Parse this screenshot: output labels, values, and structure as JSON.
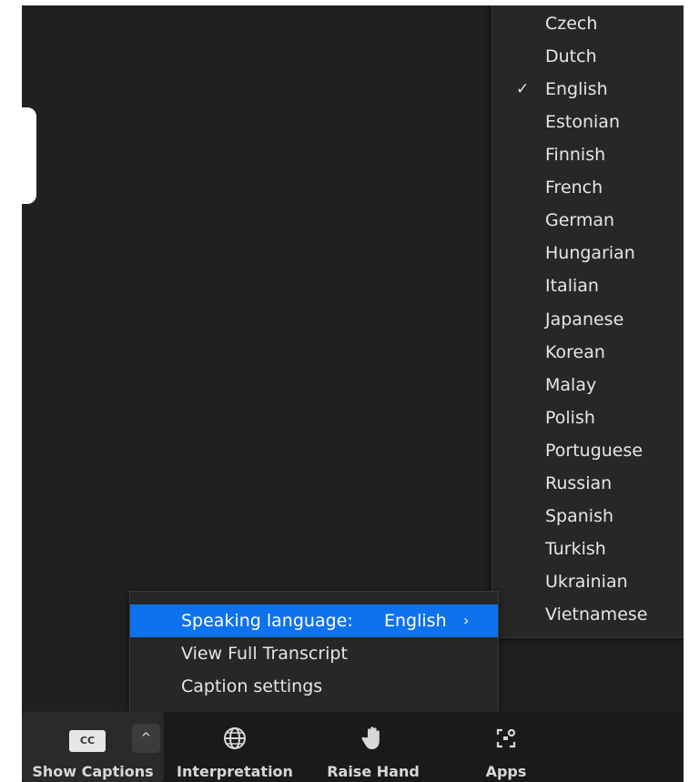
{
  "language_menu": {
    "selected": "English",
    "check_glyph": "✓",
    "items": [
      {
        "label": "Czech",
        "checked": false
      },
      {
        "label": "Dutch",
        "checked": false
      },
      {
        "label": "English",
        "checked": true
      },
      {
        "label": "Estonian",
        "checked": false
      },
      {
        "label": "Finnish",
        "checked": false
      },
      {
        "label": "French",
        "checked": false
      },
      {
        "label": "German",
        "checked": false
      },
      {
        "label": "Hungarian",
        "checked": false
      },
      {
        "label": "Italian",
        "checked": false
      },
      {
        "label": "Japanese",
        "checked": false
      },
      {
        "label": "Korean",
        "checked": false
      },
      {
        "label": "Malay",
        "checked": false
      },
      {
        "label": "Polish",
        "checked": false
      },
      {
        "label": "Portuguese",
        "checked": false
      },
      {
        "label": "Russian",
        "checked": false
      },
      {
        "label": "Spanish",
        "checked": false
      },
      {
        "label": "Turkish",
        "checked": false
      },
      {
        "label": "Ukrainian",
        "checked": false
      },
      {
        "label": "Vietnamese",
        "checked": false
      }
    ]
  },
  "caption_menu": {
    "speaking_language_label": "Speaking language:",
    "speaking_language_value": "English",
    "speaking_language_arrow": "›",
    "view_transcript_label": "View Full Transcript",
    "caption_settings_label": "Caption settings"
  },
  "toolbar": {
    "show_captions": {
      "label": "Show Captions",
      "icon": "cc-icon",
      "icon_text": "CC",
      "caret": "^"
    },
    "interpretation": {
      "label": "Interpretation",
      "icon": "globe-icon"
    },
    "raise_hand": {
      "label": "Raise Hand",
      "icon": "hand-icon"
    },
    "apps": {
      "label": "Apps",
      "icon": "apps-icon"
    }
  },
  "colors": {
    "highlight": "#0e72ed",
    "background": "#202020",
    "menu_bg": "#272727"
  }
}
